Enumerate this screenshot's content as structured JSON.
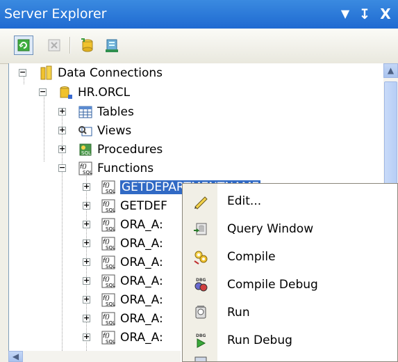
{
  "window": {
    "title": "Server Explorer",
    "pin": "d",
    "dropdown": "▾",
    "pin_glyph": "I",
    "close": "X"
  },
  "tree": {
    "root": "Data Connections",
    "connection": "HR.ORCL",
    "folders": [
      "Tables",
      "Views",
      "Procedures",
      "Functions"
    ],
    "functions": [
      "GETDEPARTMENTNAME",
      "GETDEF",
      "ORA_A:",
      "ORA_A:",
      "ORA_A:",
      "ORA_A:",
      "ORA_A:",
      "ORA_A:",
      "ORA_A:"
    ],
    "selected_function_visible": "GETDEPARTMENTNAME"
  },
  "context_menu": {
    "items": [
      {
        "label": "Edit...",
        "icon": "pencil-icon"
      },
      {
        "label": "Query Window",
        "icon": "query-window-icon"
      },
      {
        "label": "Compile",
        "icon": "compile-icon"
      },
      {
        "label": "Compile Debug",
        "icon": "compile-debug-icon"
      },
      {
        "label": "Run",
        "icon": "run-icon"
      },
      {
        "label": "Run Debug",
        "icon": "run-debug-icon"
      }
    ]
  },
  "colors": {
    "title_bar": "#1f6ad1",
    "selection": "#316ac5",
    "panel": "#f0efe7"
  }
}
